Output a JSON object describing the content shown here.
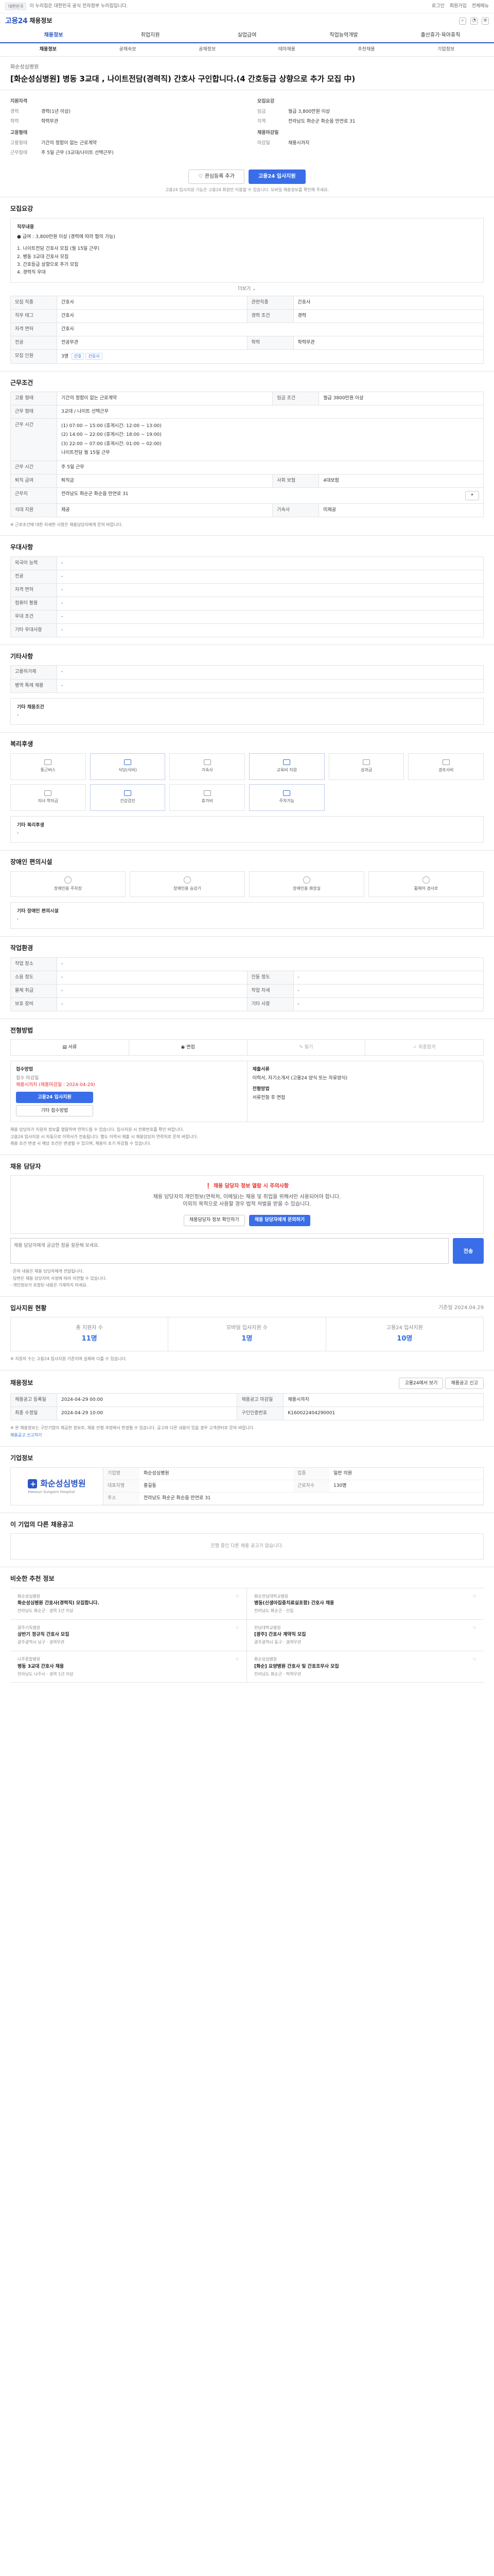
{
  "topbar": {
    "badge": "대한민국",
    "notice": "이 누리집은 대한민국 공식 전자정부 누리집입니다.",
    "links": [
      "로그인",
      "회원가입",
      "전체메뉴"
    ]
  },
  "header": {
    "logo": "고용24",
    "logo_sub": "채용정보"
  },
  "gnb": [
    "채용정보",
    "취업지원",
    "실업급여",
    "직업능력개발",
    "출산휴가·육아휴직"
  ],
  "subnav": [
    "채용정보",
    "공채속보",
    "공채정보",
    "테마채용",
    "추천채용",
    "기업정보"
  ],
  "job": {
    "org": "화순성심병원",
    "title": "[화순성심병원] 병동 3교대 , 나이트전담(경력직) 간호사 구인합니다.(4 간호등급 상향으로 추가 모집 中)",
    "apply_label": "지원자격",
    "recruit_label": "모집요강",
    "career_k": "경력",
    "career_v": "경력(1년 이상)",
    "edu_k": "학력",
    "edu_v": "학력무관",
    "wage_k": "임금",
    "wage_v": "월급 3,800만원 이상",
    "place_k": "지역",
    "place_v": "전라남도 화순군 화순읍 만연로 31",
    "cond_label": "고용형태",
    "cond1_k": "고용형태",
    "cond1_v": "기간의 정함이 없는 근로계약",
    "cond2_k": "근무형태",
    "cond2_v": "주 5일 근무 (3교대/나이트 선택근무)",
    "deadline_label": "채용마감일",
    "deadline_k": "마감일",
    "deadline_v": "채용시까지"
  },
  "actions": {
    "scrap": "관심등록 추가",
    "apply": "고용24 입사지원",
    "note": "고용24 입사지원 기능은 고용24 회원만 이용할 수 있습니다. 모바일 채용정보를 확인해 주세요."
  },
  "duty": {
    "title": "모집요강",
    "head": "직무내용",
    "lines": [
      "● 급여 : 3,800만원 이상 (경력에 따라 협의 가능)",
      "",
      "1. 나이트전담 간호사 모집 (월 15일 근무)",
      "2. 병동 3교대 간호사 모집",
      "3. 간호등급 상향으로 추가 모집",
      "4. 경력직 우대"
    ],
    "more": "더보기"
  },
  "recruit_table": {
    "rows": [
      [
        "모집 직종",
        "간호사",
        "관련직종",
        "간호사"
      ],
      [
        "직무 태그",
        "간호사",
        "경력 조건",
        "경력"
      ],
      [
        "자격 면허",
        "간호사",
        "",
        ""
      ],
      [
        "전공",
        "전공무관",
        "학력",
        "학력무관"
      ],
      [
        "모집 인원",
        "3명",
        "",
        ""
      ]
    ],
    "tags": [
      "간호",
      "간호사"
    ]
  },
  "workcond": {
    "title": "근무조건",
    "rows": [
      [
        "고용 형태",
        "기간의 정함이 없는 근로계약",
        "임금 조건",
        "월급 3800만원 이상"
      ],
      [
        "근무 시간",
        "주 5일 근무",
        "",
        ""
      ],
      [
        "근무지",
        "전라남도 화순군 화순읍 만연로 31",
        "",
        ""
      ]
    ],
    "hours": [
      "근무 형태",
      "3교대 / 나이트 선택근무",
      "근무 시간",
      "(1) 07:00 ~ 15:00 (휴게시간: 12:00 ~ 13:00)",
      "(2) 14:00 ~ 22:00 (휴게시간: 18:00 ~ 19:00)",
      "(3) 22:00 ~ 07:00 (휴게시간: 01:00 ~ 02:00)",
      "나이트전담 월 15일 근무"
    ],
    "extra": [
      [
        "퇴직 급여",
        "퇴직금",
        "사회 보험",
        "4대보험"
      ],
      [
        "식대 지원",
        "제공",
        "기숙사",
        "미제공"
      ]
    ],
    "note": "※ 근로조건에 대한 자세한 사항은 채용담당자에게 문의 바랍니다."
  },
  "pref": {
    "title": "우대사항",
    "rows": [
      [
        "외국어 능력",
        "-"
      ],
      [
        "전공",
        "-"
      ],
      [
        "자격 면허",
        "-"
      ],
      [
        "컴퓨터 활용",
        "-"
      ],
      [
        "우대 조건",
        "-"
      ],
      [
        "기타 우대사항",
        "-"
      ]
    ]
  },
  "etc": {
    "title": "기타사항",
    "rows": [
      [
        "고용허가제",
        "-"
      ],
      [
        "병역 특례 채용",
        "-"
      ]
    ],
    "etc_head": "기타 채용조건",
    "etc_val": "-"
  },
  "welfare": {
    "title": "복리후생",
    "items": [
      {
        "icon": "car-icon",
        "label": "통근버스",
        "on": false
      },
      {
        "icon": "meal-icon",
        "label": "식당(식비)",
        "on": true
      },
      {
        "icon": "home-icon",
        "label": "기숙사",
        "on": false
      },
      {
        "icon": "edu-icon",
        "label": "교육비 지원",
        "on": true
      },
      {
        "icon": "bonus-icon",
        "label": "성과급",
        "on": false
      },
      {
        "icon": "gift-icon",
        "label": "경조사비",
        "on": false
      },
      {
        "icon": "rest-icon",
        "label": "자녀 학자금",
        "on": false
      },
      {
        "icon": "health-icon",
        "label": "건강검진",
        "on": true
      },
      {
        "icon": "vacation-icon",
        "label": "휴가비",
        "on": false
      },
      {
        "icon": "parking-icon",
        "label": "주차가능",
        "on": true
      }
    ],
    "other_head": "기타 복리후생",
    "other_val": "-"
  },
  "disability": {
    "title": "장애인 편의시설",
    "items": [
      "장애인용 주차장",
      "장애인용 승강기",
      "장애인용 화장실",
      "휠체어 경사로"
    ],
    "other_head": "기타 장애인 편의시설",
    "other_val": "-"
  },
  "company_env": {
    "title": "작업환경",
    "rows": [
      [
        "작업 장소",
        "-",
        "",
        ""
      ],
      [
        "소음 정도",
        "-",
        "진동 정도",
        "-"
      ],
      [
        "물체 취급",
        "-",
        "작업 자세",
        "-"
      ],
      [
        "보호 장비",
        "-",
        "기타 사항",
        "-"
      ]
    ]
  },
  "procedure": {
    "title": "전형방법",
    "steps": [
      "서류",
      "면접",
      "필기",
      "최종합격"
    ],
    "apply_col_head": "접수방법",
    "apply_period_k": "접수 마감일",
    "apply_period_v": "채용시까지 (채용마감일 : 2024-04-29)",
    "apply_btn": "고용24 입사지원",
    "email_btn": "기타 접수방법",
    "doc_head": "제출서류",
    "doc_v": "이력서, 자기소개서 (고용24 양식 또는 자유양식)",
    "method_head": "전형방법",
    "method_v": "서류전형 후 면접",
    "bullets": [
      "채용 담당자가 지원자 정보를 열람하여 연락드릴 수 있습니다. 입사지원 시 전화번호를 확인 바랍니다.",
      "고용24 입사지원 시 자동으로 이력서가 전송됩니다. 별도 이력서 제출 시 채용담당자 연락처로 문의 바랍니다.",
      "채용 조건 변경 시 해당 조건은 변경될 수 있으며, 채용이 조기 마감될 수 있습니다."
    ]
  },
  "contact": {
    "title": "채용 담당자",
    "warn": "채용 담당자 정보 열람 시 주의사항",
    "desc1": "채용 담당자의 개인정보(연락처, 이메일)는 채용 및 취업을 위해서만 사용되어야 합니다.",
    "desc2": "이외의 목적으로 사용할 경우 법적 처벌을 받을 수 있습니다.",
    "btn1": "채용담당자 정보 확인하기",
    "btn2": "채용 담당자에게 문의하기",
    "qa_placeholder": "채용 담당자에게 궁금한 점을 질문해 보세요.",
    "qa_btn": "전송",
    "bullets": [
      "· 문의 내용은 채용 담당자에게 전달됩니다.",
      "· 답변은 채용 담당자의 사정에 따라 지연될 수 있습니다.",
      "· 개인정보가 포함된 내용은 기재하지 마세요."
    ]
  },
  "status": {
    "title": "입사지원 현황",
    "updated": "기준일 2024.04.29",
    "c1_k": "총 지원자 수",
    "c1_v": "11명",
    "c2_k": "모바일 입사지원 수",
    "c2_v": "1명",
    "c3_k": "고용24 입사지원",
    "c3_v": "10명",
    "note": "※ 지원자 수는 고용24 입사지원 기준이며 실제와 다를 수 있습니다."
  },
  "recinfo": {
    "title": "채용정보",
    "btn1": "고용24에서 보기",
    "btn2": "채용공고 신고",
    "rows": [
      [
        "채용공고 등록일",
        "2024-04-29 00:00",
        "채용공고 마감일",
        "채용시까지"
      ],
      [
        "최종 수정일",
        "2024-04-29 10:00",
        "구인인증번호",
        "K160022404290001"
      ]
    ],
    "disclaimer": "※ 본 채용정보는 구인기업이 제공한 정보로, 채용 진행 과정에서 변경될 수 있습니다. 공고와 다른 내용이 있을 경우 고객센터로 문의 바랍니다.",
    "report": "채용공고 신고하기"
  },
  "company": {
    "title": "기업정보",
    "name": "화순성심병원",
    "en": "Hwasun Sungsim Hospital",
    "rows": [
      [
        "기업명",
        "화순성심병원",
        "업종",
        "일반 의원"
      ],
      [
        "대표자명",
        "홍길동",
        "근로자수",
        "130명"
      ],
      [
        "주소",
        "전라남도 화순군 화순읍 만연로 31",
        "",
        ""
      ]
    ]
  },
  "others": {
    "title": "이 기업의 다른 채용공고",
    "empty": "진행 중인 다른 채용 공고가 없습니다.",
    "rec_title": "비슷한 추천 정보",
    "jobs": [
      {
        "org": "화순성심병원",
        "title": "화순성심병원 간호사(경력직) 모집합니다.",
        "meta": "전라남도 화순군 · 경력 1년 이상"
      },
      {
        "org": "화순전남대학교병원",
        "title": "병동(신생아집중치료실포함) 간호사 채용",
        "meta": "전라남도 화순군 · 신입"
      },
      {
        "org": "광주기독병원",
        "title": "상반기 정규직 간호사 모집",
        "meta": "광주광역시 남구 · 경력무관"
      },
      {
        "org": "전남대학교병원",
        "title": "[광주] 간호사 계약직 모집",
        "meta": "광주광역시 동구 · 경력무관"
      },
      {
        "org": "나주종합병원",
        "title": "병동 3교대 간호사 채용",
        "meta": "전라남도 나주시 · 경력 1년 이상"
      },
      {
        "org": "화순성심병원",
        "title": "[화순] 요양병원 간호사 및 간호조무사 모집",
        "meta": "전라남도 화순군 · 학력무관"
      }
    ]
  }
}
